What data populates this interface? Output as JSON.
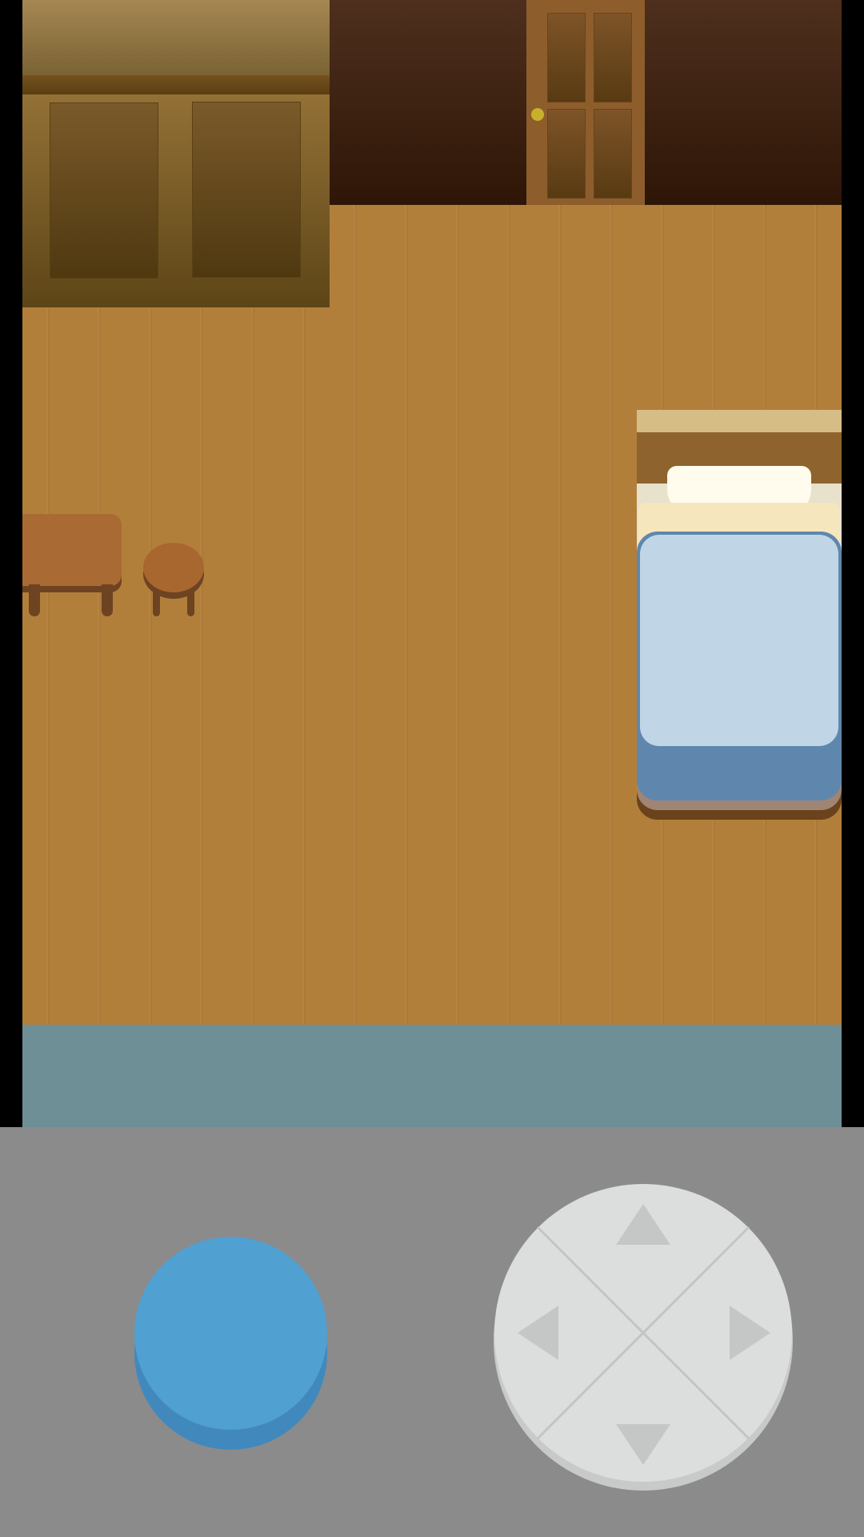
{
  "scene": {
    "room": "bedroom",
    "objects": [
      "wardrobe",
      "door",
      "table",
      "stool",
      "bed"
    ]
  },
  "colors": {
    "floor": "#b27f3b",
    "wall": "#4e2f1d",
    "water": "#6f8f97",
    "control_panel": "#8b8b8b",
    "action_button": "#50a0d2",
    "dpad": "#dcdddd",
    "dpad_arrows": "#c5c6c6"
  },
  "controls": {
    "action_button": "",
    "dpad": {
      "directions": [
        "up",
        "down",
        "left",
        "right"
      ],
      "icons": [
        "arrow-up-icon",
        "arrow-down-icon",
        "arrow-left-icon",
        "arrow-right-icon"
      ]
    }
  }
}
